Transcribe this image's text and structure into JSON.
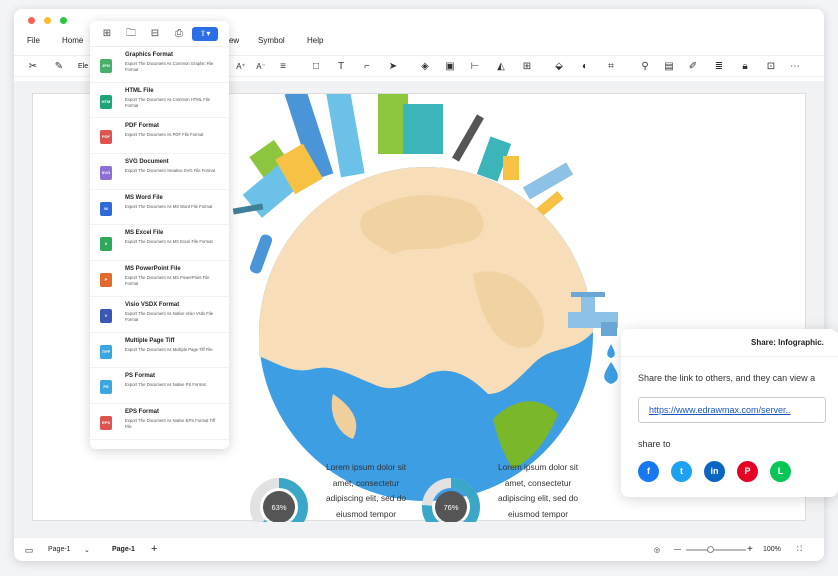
{
  "menu": [
    "File",
    "Home",
    "View",
    "Symbol",
    "Help"
  ],
  "toolbar": {
    "font_input": "Ele"
  },
  "export_menu": {
    "formats": [
      {
        "badge": "JPG",
        "title": "Graphics Format",
        "desc": "Export The Document As Common Graphic File Format",
        "color": "#46b06a"
      },
      {
        "badge": "HTM",
        "title": "HTML File",
        "desc": "Export The Document As Common HTML File Format",
        "color": "#1fa37a"
      },
      {
        "badge": "PDF",
        "title": "PDF Format",
        "desc": "Export The Document As PDF File Format",
        "color": "#e0524d"
      },
      {
        "badge": "SVG",
        "title": "SVG Document",
        "desc": "Export The Document Asnative SVG File Format",
        "color": "#8d6fd6"
      },
      {
        "badge": "W",
        "title": "MS Word File",
        "desc": "Export The Document As MS Word File Format",
        "color": "#2f6ad9"
      },
      {
        "badge": "X",
        "title": "MS Excel File",
        "desc": "Export The Document As MS Excel File Format",
        "color": "#2ea85a"
      },
      {
        "badge": "P",
        "title": "MS PowerPoint File",
        "desc": "Export The Document As MS PowerPoint File Format",
        "color": "#e06b2c"
      },
      {
        "badge": "V",
        "title": "Visio VSDX Format",
        "desc": "Export The Document As Native Visio Vsdx File Format",
        "color": "#3956b5"
      },
      {
        "badge": "TIFF",
        "title": "Multiple Page Tiff",
        "desc": "Export The Document As Multiple Page Tiff File",
        "color": "#3aa7e0"
      },
      {
        "badge": "PS",
        "title": "PS Format",
        "desc": "Export The Document As Native PS Format",
        "color": "#3aa7e0"
      },
      {
        "badge": "EPS",
        "title": "EPS Format",
        "desc": "Export The Document As Native EPS Format Tiff File",
        "color": "#e0524d"
      }
    ]
  },
  "infographic": {
    "lorem_1": "Lorem ipsum dolor sit amet, consectetur adipiscing elit, sed do eiusmod tempor",
    "lorem_2": "Lorem ipsum dolor sit amet, consectetur adipiscing elit, sed do eiusmod tempor",
    "donut_1": "63%",
    "donut_2": "76%",
    "donut_1_fraction": 0.63,
    "donut_2_fraction": 0.76
  },
  "share": {
    "title": "Share: Infographic.",
    "text": "Share the link to others, and they can view a",
    "link": "https://www.edrawmax.com/server..",
    "share_to": "share to",
    "socials": [
      {
        "name": "f",
        "color": "#1877f2"
      },
      {
        "name": "t",
        "color": "#1da1f2"
      },
      {
        "name": "in",
        "color": "#0a66c2"
      },
      {
        "name": "P",
        "color": "#e60023"
      },
      {
        "name": "L",
        "color": "#06c755"
      }
    ]
  },
  "status": {
    "page_selector": "Page-1",
    "page_tab": "Page-1",
    "zoom": "100%"
  }
}
